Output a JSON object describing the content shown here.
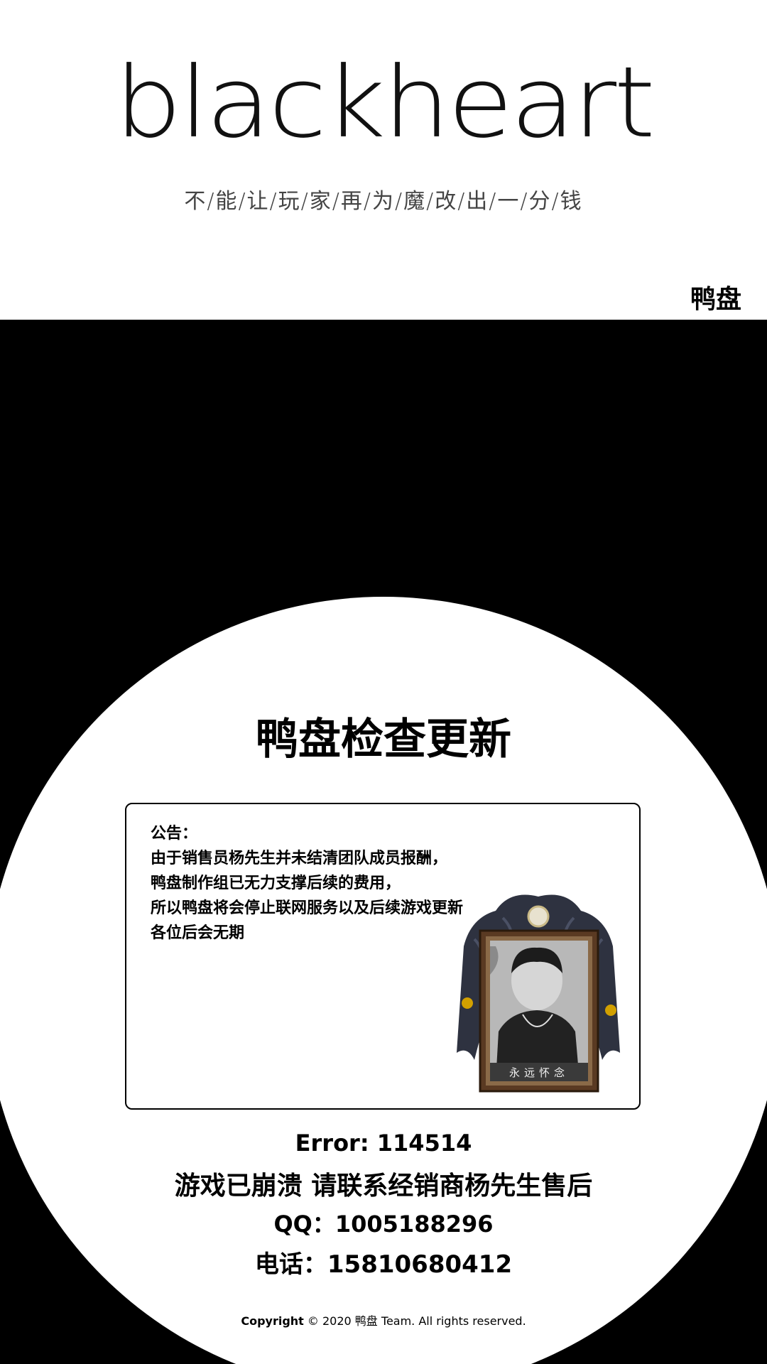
{
  "header": {
    "logo_text": "blackheart",
    "slogan": "不/能/让/玩/家/再/为/魔/改/出/一/分/钱",
    "brand": "鸭盘"
  },
  "dialog": {
    "title": "鸭盘检查更新",
    "notice_lines": [
      "公告：",
      "由于销售员杨先生并未结清团队成员报酬，",
      "鸭盘制作组已无力支撑后续的费用，",
      "所以鸭盘将会停止联网服务以及后续游戏更新",
      "各位后会无期"
    ],
    "portrait_caption": "永远怀念",
    "error": "Error: 114514",
    "crash_message": "游戏已崩溃 请联系经销商杨先生售后",
    "qq": "QQ：1005188296",
    "phone": "电话：15810680412"
  },
  "footer": {
    "copyright_label": "Copyright",
    "copyright_rest": "© 2020 鸭盘 Team. All rights reserved."
  }
}
